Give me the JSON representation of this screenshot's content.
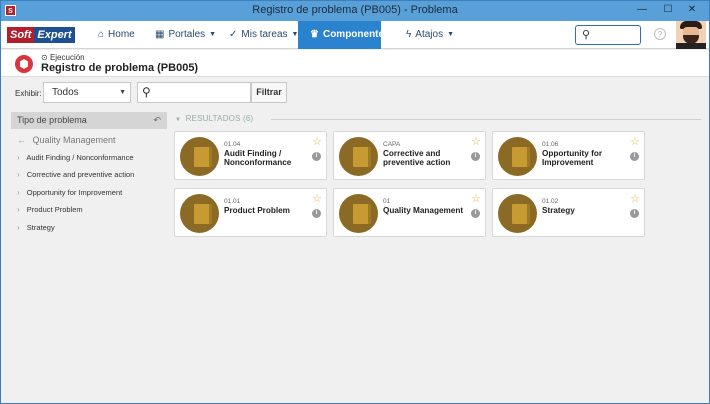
{
  "window": {
    "title": "Registro de problema (PB005) - Problema",
    "app_icon_text": "S",
    "minimize": "—",
    "maximize": "☐",
    "close": "✕"
  },
  "navbar": {
    "logo_soft": "Soft",
    "logo_expert": "Expert",
    "items": [
      {
        "label": "Home",
        "icon": "home-icon"
      },
      {
        "label": "Portales",
        "icon": "grid-icon"
      },
      {
        "label": "Mis tareas",
        "icon": "check-icon"
      },
      {
        "label": "Componentes",
        "icon": "trophy-icon"
      },
      {
        "label": "Atajos",
        "icon": "bolt-icon"
      }
    ],
    "search_placeholder": "",
    "help": "?"
  },
  "header": {
    "mode": "Ejecución",
    "title": "Registro de problema (PB005)"
  },
  "filter": {
    "label": "Exhibir:",
    "selected": "Todos",
    "search_value": "",
    "button": "Filtrar"
  },
  "sidebar": {
    "title": "Tipo de problema",
    "root": "Quality Management",
    "items": [
      "Audit Finding / Nonconformance",
      "Corrective and preventive action",
      "Opportunity for Improvement",
      "Product Problem",
      "Strategy"
    ]
  },
  "results": {
    "label": "RESULTADOS (6)",
    "cards": [
      {
        "code": "01.04",
        "name": "Audit Finding / Nonconformance"
      },
      {
        "code": "CAPA",
        "name": "Corrective and preventive action"
      },
      {
        "code": "01.06",
        "name": "Opportunity for Improvement"
      },
      {
        "code": "01.01",
        "name": "Product Problem"
      },
      {
        "code": "01",
        "name": "Quality Management"
      },
      {
        "code": "01.02",
        "name": "Strategy"
      }
    ]
  },
  "colors": {
    "accent": "#2b83d0",
    "card_icon": "#8a6a24",
    "star": "#e2b43a"
  }
}
